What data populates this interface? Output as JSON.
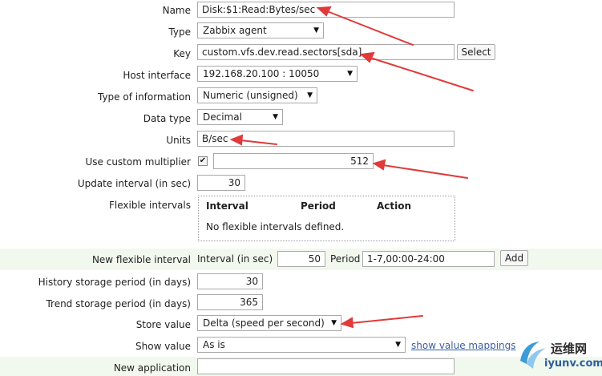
{
  "form": {
    "name": {
      "label": "Name",
      "value": "Disk:$1:Read:Bytes/sec"
    },
    "type": {
      "label": "Type",
      "value": "Zabbix agent"
    },
    "key": {
      "label": "Key",
      "value": "custom.vfs.dev.read.sectors[sda]",
      "button": "Select"
    },
    "host_interface": {
      "label": "Host interface",
      "value": "192.168.20.100 : 10050"
    },
    "type_of_information": {
      "label": "Type of information",
      "value": "Numeric (unsigned)"
    },
    "data_type": {
      "label": "Data type",
      "value": "Decimal"
    },
    "units": {
      "label": "Units",
      "value": "B/sec"
    },
    "custom_multiplier": {
      "label": "Use custom multiplier",
      "checked": true,
      "value": "512"
    },
    "update_interval": {
      "label": "Update interval (in sec)",
      "value": "30"
    },
    "flexible_intervals": {
      "label": "Flexible intervals",
      "columns": [
        "Interval",
        "Period",
        "Action"
      ],
      "empty_text": "No flexible intervals defined."
    },
    "new_flexible_interval": {
      "label": "New flexible interval",
      "interval_label": "Interval (in sec)",
      "interval_value": "50",
      "period_label": "Period",
      "period_value": "1-7,00:00-24:00",
      "button": "Add"
    },
    "history": {
      "label": "History storage period (in days)",
      "value": "30"
    },
    "trend": {
      "label": "Trend storage period (in days)",
      "value": "365"
    },
    "store_value": {
      "label": "Store value",
      "value": "Delta (speed per second)"
    },
    "show_value": {
      "label": "Show value",
      "value": "As is",
      "link": "show value mappings"
    },
    "new_application": {
      "label": "New application",
      "value": ""
    }
  },
  "colors": {
    "band": "#f1f9ee",
    "arrow": "#e03a3a",
    "link": "#3a5fa0"
  },
  "watermark": {
    "text_cn": "运维网",
    "text_url": "iyunv.com"
  }
}
